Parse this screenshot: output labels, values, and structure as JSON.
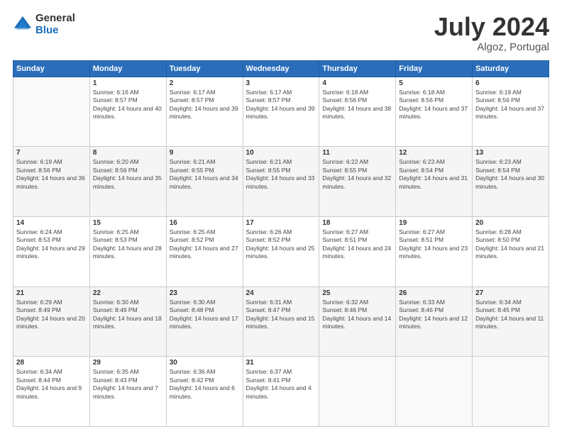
{
  "logo": {
    "general": "General",
    "blue": "Blue"
  },
  "title": {
    "month": "July 2024",
    "location": "Algoz, Portugal"
  },
  "days_header": [
    "Sunday",
    "Monday",
    "Tuesday",
    "Wednesday",
    "Thursday",
    "Friday",
    "Saturday"
  ],
  "weeks": [
    [
      {
        "day": "",
        "sunrise": "",
        "sunset": "",
        "daylight": ""
      },
      {
        "day": "1",
        "sunrise": "Sunrise: 6:16 AM",
        "sunset": "Sunset: 8:57 PM",
        "daylight": "Daylight: 14 hours and 40 minutes."
      },
      {
        "day": "2",
        "sunrise": "Sunrise: 6:17 AM",
        "sunset": "Sunset: 8:57 PM",
        "daylight": "Daylight: 14 hours and 39 minutes."
      },
      {
        "day": "3",
        "sunrise": "Sunrise: 6:17 AM",
        "sunset": "Sunset: 8:57 PM",
        "daylight": "Daylight: 14 hours and 39 minutes."
      },
      {
        "day": "4",
        "sunrise": "Sunrise: 6:18 AM",
        "sunset": "Sunset: 8:56 PM",
        "daylight": "Daylight: 14 hours and 38 minutes."
      },
      {
        "day": "5",
        "sunrise": "Sunrise: 6:18 AM",
        "sunset": "Sunset: 8:56 PM",
        "daylight": "Daylight: 14 hours and 37 minutes."
      },
      {
        "day": "6",
        "sunrise": "Sunrise: 6:19 AM",
        "sunset": "Sunset: 8:56 PM",
        "daylight": "Daylight: 14 hours and 37 minutes."
      }
    ],
    [
      {
        "day": "7",
        "sunrise": "Sunrise: 6:19 AM",
        "sunset": "Sunset: 8:56 PM",
        "daylight": "Daylight: 14 hours and 36 minutes."
      },
      {
        "day": "8",
        "sunrise": "Sunrise: 6:20 AM",
        "sunset": "Sunset: 8:56 PM",
        "daylight": "Daylight: 14 hours and 35 minutes."
      },
      {
        "day": "9",
        "sunrise": "Sunrise: 6:21 AM",
        "sunset": "Sunset: 8:55 PM",
        "daylight": "Daylight: 14 hours and 34 minutes."
      },
      {
        "day": "10",
        "sunrise": "Sunrise: 6:21 AM",
        "sunset": "Sunset: 8:55 PM",
        "daylight": "Daylight: 14 hours and 33 minutes."
      },
      {
        "day": "11",
        "sunrise": "Sunrise: 6:22 AM",
        "sunset": "Sunset: 8:55 PM",
        "daylight": "Daylight: 14 hours and 32 minutes."
      },
      {
        "day": "12",
        "sunrise": "Sunrise: 6:23 AM",
        "sunset": "Sunset: 8:54 PM",
        "daylight": "Daylight: 14 hours and 31 minutes."
      },
      {
        "day": "13",
        "sunrise": "Sunrise: 6:23 AM",
        "sunset": "Sunset: 8:54 PM",
        "daylight": "Daylight: 14 hours and 30 minutes."
      }
    ],
    [
      {
        "day": "14",
        "sunrise": "Sunrise: 6:24 AM",
        "sunset": "Sunset: 8:53 PM",
        "daylight": "Daylight: 14 hours and 29 minutes."
      },
      {
        "day": "15",
        "sunrise": "Sunrise: 6:25 AM",
        "sunset": "Sunset: 8:53 PM",
        "daylight": "Daylight: 14 hours and 28 minutes."
      },
      {
        "day": "16",
        "sunrise": "Sunrise: 6:25 AM",
        "sunset": "Sunset: 8:52 PM",
        "daylight": "Daylight: 14 hours and 27 minutes."
      },
      {
        "day": "17",
        "sunrise": "Sunrise: 6:26 AM",
        "sunset": "Sunset: 8:52 PM",
        "daylight": "Daylight: 14 hours and 25 minutes."
      },
      {
        "day": "18",
        "sunrise": "Sunrise: 6:27 AM",
        "sunset": "Sunset: 8:51 PM",
        "daylight": "Daylight: 14 hours and 24 minutes."
      },
      {
        "day": "19",
        "sunrise": "Sunrise: 6:27 AM",
        "sunset": "Sunset: 8:51 PM",
        "daylight": "Daylight: 14 hours and 23 minutes."
      },
      {
        "day": "20",
        "sunrise": "Sunrise: 6:28 AM",
        "sunset": "Sunset: 8:50 PM",
        "daylight": "Daylight: 14 hours and 21 minutes."
      }
    ],
    [
      {
        "day": "21",
        "sunrise": "Sunrise: 6:29 AM",
        "sunset": "Sunset: 8:49 PM",
        "daylight": "Daylight: 14 hours and 20 minutes."
      },
      {
        "day": "22",
        "sunrise": "Sunrise: 6:30 AM",
        "sunset": "Sunset: 8:49 PM",
        "daylight": "Daylight: 14 hours and 18 minutes."
      },
      {
        "day": "23",
        "sunrise": "Sunrise: 6:30 AM",
        "sunset": "Sunset: 8:48 PM",
        "daylight": "Daylight: 14 hours and 17 minutes."
      },
      {
        "day": "24",
        "sunrise": "Sunrise: 6:31 AM",
        "sunset": "Sunset: 8:47 PM",
        "daylight": "Daylight: 14 hours and 15 minutes."
      },
      {
        "day": "25",
        "sunrise": "Sunrise: 6:32 AM",
        "sunset": "Sunset: 8:46 PM",
        "daylight": "Daylight: 14 hours and 14 minutes."
      },
      {
        "day": "26",
        "sunrise": "Sunrise: 6:33 AM",
        "sunset": "Sunset: 8:46 PM",
        "daylight": "Daylight: 14 hours and 12 minutes."
      },
      {
        "day": "27",
        "sunrise": "Sunrise: 6:34 AM",
        "sunset": "Sunset: 8:45 PM",
        "daylight": "Daylight: 14 hours and 11 minutes."
      }
    ],
    [
      {
        "day": "28",
        "sunrise": "Sunrise: 6:34 AM",
        "sunset": "Sunset: 8:44 PM",
        "daylight": "Daylight: 14 hours and 9 minutes."
      },
      {
        "day": "29",
        "sunrise": "Sunrise: 6:35 AM",
        "sunset": "Sunset: 8:43 PM",
        "daylight": "Daylight: 14 hours and 7 minutes."
      },
      {
        "day": "30",
        "sunrise": "Sunrise: 6:36 AM",
        "sunset": "Sunset: 8:42 PM",
        "daylight": "Daylight: 14 hours and 6 minutes."
      },
      {
        "day": "31",
        "sunrise": "Sunrise: 6:37 AM",
        "sunset": "Sunset: 8:41 PM",
        "daylight": "Daylight: 14 hours and 4 minutes."
      },
      {
        "day": "",
        "sunrise": "",
        "sunset": "",
        "daylight": ""
      },
      {
        "day": "",
        "sunrise": "",
        "sunset": "",
        "daylight": ""
      },
      {
        "day": "",
        "sunrise": "",
        "sunset": "",
        "daylight": ""
      }
    ]
  ]
}
